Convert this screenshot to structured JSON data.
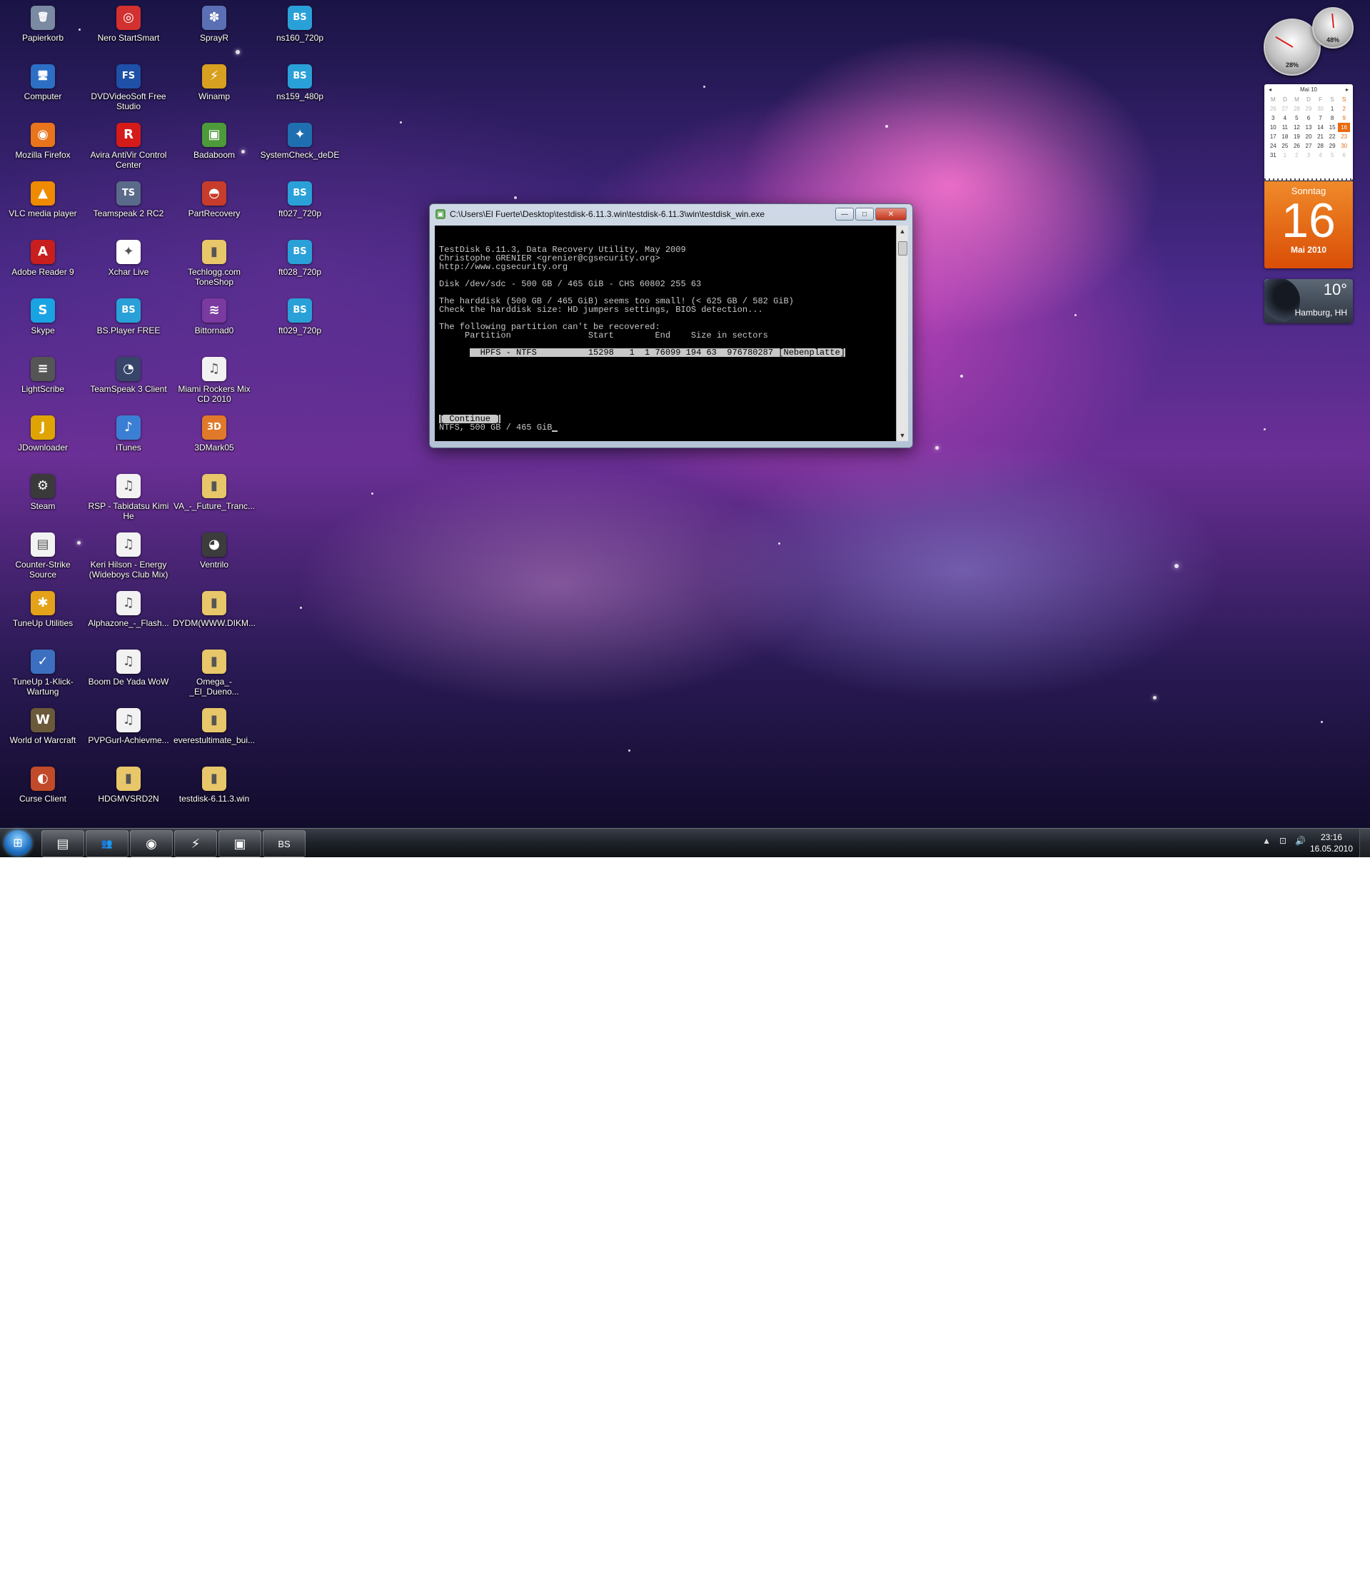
{
  "desktop_icons": [
    {
      "label": "Papierkorb",
      "icon": "recycle-bin-icon",
      "color": "#7b8aa3",
      "glyph": "🗑"
    },
    {
      "label": "Computer",
      "icon": "computer-icon",
      "color": "#2d6fc4",
      "glyph": "🖥"
    },
    {
      "label": "Mozilla Firefox",
      "icon": "firefox-icon",
      "color": "#e8741c",
      "glyph": "◉"
    },
    {
      "label": "VLC media player",
      "icon": "vlc-icon",
      "color": "#f08a00",
      "glyph": "▲"
    },
    {
      "label": "Adobe Reader 9",
      "icon": "adobe-reader-icon",
      "color": "#c81e1e",
      "glyph": "A"
    },
    {
      "label": "Skype",
      "icon": "skype-icon",
      "color": "#1aa3e3",
      "glyph": "S"
    },
    {
      "label": "LightScribe",
      "icon": "lightscribe-icon",
      "color": "#555555",
      "glyph": "≡"
    },
    {
      "label": "JDownloader",
      "icon": "jdownloader-icon",
      "color": "#e0a400",
      "glyph": "J"
    },
    {
      "label": "Steam",
      "icon": "steam-icon",
      "color": "#3a3a3a",
      "glyph": "⚙"
    },
    {
      "label": "Counter-Strike Source",
      "icon": "document-icon",
      "color": "#f2f2f2",
      "glyph": "▤"
    },
    {
      "label": "TuneUp Utilities",
      "icon": "tuneup-icon",
      "color": "#e3a21a",
      "glyph": "✱"
    },
    {
      "label": "TuneUp 1-Klick-Wartung",
      "icon": "tuneup-wartung-icon",
      "color": "#3c6fc0",
      "glyph": "✓"
    },
    {
      "label": "World of Warcraft",
      "icon": "wow-icon",
      "color": "#6b5a3a",
      "glyph": "W"
    },
    {
      "label": "Curse Client",
      "icon": "curse-client-icon",
      "color": "#c04a2a",
      "glyph": "◐"
    },
    {
      "label": "Nero StartSmart",
      "icon": "nero-icon",
      "color": "#d33030",
      "glyph": "◎"
    },
    {
      "label": "DVDVideoSoft Free Studio",
      "icon": "dvdvideosoft-icon",
      "color": "#1e50a8",
      "glyph": "FS"
    },
    {
      "label": "Avira AntiVir Control Center",
      "icon": "avira-icon",
      "color": "#d51a1a",
      "glyph": "R"
    },
    {
      "label": "Teamspeak 2 RC2",
      "icon": "teamspeak2-icon",
      "color": "#5a6a8a",
      "glyph": "TS"
    },
    {
      "label": "Xchar Live",
      "icon": "xchar-icon",
      "color": "#ffffff",
      "glyph": "✦"
    },
    {
      "label": "BS.Player FREE",
      "icon": "bsplayer-icon",
      "color": "#2aa0d8",
      "glyph": "BS"
    },
    {
      "label": "TeamSpeak 3 Client",
      "icon": "teamspeak3-icon",
      "color": "#38456a",
      "glyph": "◔"
    },
    {
      "label": "iTunes",
      "icon": "itunes-icon",
      "color": "#3b7fd4",
      "glyph": "♪"
    },
    {
      "label": "RSP - Tabidatsu Kimi He",
      "icon": "audio-file-icon",
      "color": "#f2f2f2",
      "glyph": "♫"
    },
    {
      "label": "Keri Hilson - Energy (Wideboys Club Mix)",
      "icon": "audio-file-icon",
      "color": "#f2f2f2",
      "glyph": "♫"
    },
    {
      "label": "Alphazone_-_Flash...",
      "icon": "audio-file-icon",
      "color": "#f2f2f2",
      "glyph": "♫"
    },
    {
      "label": "Boom De Yada WoW",
      "icon": "audio-file-icon",
      "color": "#f2f2f2",
      "glyph": "♫"
    },
    {
      "label": "PVPGurl-Achievme...",
      "icon": "audio-file-icon",
      "color": "#f2f2f2",
      "glyph": "♫"
    },
    {
      "label": "HDGMVSRD2N",
      "icon": "folder-icon",
      "color": "#e8c66a",
      "glyph": "▮"
    },
    {
      "label": "SprayR",
      "icon": "sprayr-icon",
      "color": "#5a6fb4",
      "glyph": "✽"
    },
    {
      "label": "Winamp",
      "icon": "winamp-icon",
      "color": "#d8a020",
      "glyph": "⚡"
    },
    {
      "label": "Badaboom",
      "icon": "badaboom-icon",
      "color": "#4d9a3a",
      "glyph": "▣"
    },
    {
      "label": "PartRecovery",
      "icon": "partrecovery-icon",
      "color": "#c83c2c",
      "glyph": "◓"
    },
    {
      "label": "Techlogg.com ToneShop",
      "icon": "folder-icon",
      "color": "#e8c66a",
      "glyph": "▮"
    },
    {
      "label": "Bittornad0",
      "icon": "bittornado-icon",
      "color": "#7a3aa0",
      "glyph": "≋"
    },
    {
      "label": "Miami Rockers Mix CD 2010",
      "icon": "audio-file-icon",
      "color": "#f2f2f2",
      "glyph": "♫"
    },
    {
      "label": "3DMark05",
      "icon": "3dmark-icon",
      "color": "#e07a2a",
      "glyph": "3D"
    },
    {
      "label": "VA_-_Future_Tranc...",
      "icon": "folder-icon",
      "color": "#e8c66a",
      "glyph": "▮"
    },
    {
      "label": "Ventrilo",
      "icon": "ventrilo-icon",
      "color": "#3c3c3c",
      "glyph": "◕"
    },
    {
      "label": "DYDM(WWW.DIKM...",
      "icon": "folder-icon",
      "color": "#e8c66a",
      "glyph": "▮"
    },
    {
      "label": "Omega_-_El_Dueno...",
      "icon": "folder-icon",
      "color": "#e8c66a",
      "glyph": "▮"
    },
    {
      "label": "everestultimate_bui...",
      "icon": "folder-icon",
      "color": "#e8c66a",
      "glyph": "▮"
    },
    {
      "label": "testdisk-6.11.3.win",
      "icon": "folder-icon",
      "color": "#e8c66a",
      "glyph": "▮"
    },
    {
      "label": "ns160_720p",
      "icon": "bsplayer-file-icon",
      "color": "#2aa0d8",
      "glyph": "BS"
    },
    {
      "label": "ns159_480p",
      "icon": "bsplayer-file-icon",
      "color": "#2aa0d8",
      "glyph": "BS"
    },
    {
      "label": "SystemCheck_deDE",
      "icon": "systemcheck-icon",
      "color": "#1f6fb0",
      "glyph": "✦"
    },
    {
      "label": "ft027_720p",
      "icon": "bsplayer-file-icon",
      "color": "#2aa0d8",
      "glyph": "BS"
    },
    {
      "label": "ft028_720p",
      "icon": "bsplayer-file-icon",
      "color": "#2aa0d8",
      "glyph": "BS"
    },
    {
      "label": "ft029_720p",
      "icon": "bsplayer-file-icon",
      "color": "#2aa0d8",
      "glyph": "BS"
    }
  ],
  "console_window": {
    "title": "C:\\Users\\El Fuerte\\Desktop\\testdisk-6.11.3.win\\testdisk-6.11.3\\win\\testdisk_win.exe",
    "buttons": {
      "minimize": "—",
      "maximize": "□",
      "close": "✕"
    },
    "lines": [
      "TestDisk 6.11.3, Data Recovery Utility, May 2009",
      "Christophe GRENIER <grenier@cgsecurity.org>",
      "http://www.cgsecurity.org",
      "",
      "Disk /dev/sdc - 500 GB / 465 GiB - CHS 60802 255 63",
      "",
      "The harddisk (500 GB / 465 GiB) seems too small! (< 625 GB / 582 GiB)",
      "Check the harddisk size: HD jumpers settings, BIOS detection...",
      "",
      "The following partition can't be recovered:",
      "     Partition               Start        End    Size in sectors"
    ],
    "selected_row": "  HPFS - NTFS          15298   1  1 76099 194 63  976780287 [Nebenplatte]",
    "continue_label": "[ Continue ]",
    "bottom_line": "NTFS, 500 GB / 465 GiB"
  },
  "taskbar": {
    "start_label": "Start",
    "pinned": [
      {
        "name": "explorer",
        "icon": "folder-icon",
        "glyph": "▤"
      },
      {
        "name": "users",
        "icon": "users-icon",
        "glyph": "👥"
      },
      {
        "name": "firefox",
        "icon": "firefox-icon",
        "glyph": "◉"
      },
      {
        "name": "winamp",
        "icon": "winamp-icon",
        "glyph": "⚡"
      },
      {
        "name": "testdisk",
        "icon": "console-icon",
        "glyph": "▣"
      },
      {
        "name": "bsplayer",
        "icon": "bsplayer-icon",
        "glyph": "BS"
      }
    ],
    "tray": {
      "up_arrow": "▲",
      "network": "⊡",
      "volume": "🔊"
    },
    "clock_time": "23:16",
    "clock_date": "16.05.2010"
  },
  "gadgets": {
    "cpu_meter": {
      "cpu_percent": 28,
      "cpu_label": "28%",
      "ram_percent": 48,
      "ram_label": "48%"
    },
    "calendar": {
      "month_label": "Mai 10",
      "weekdays": [
        "M",
        "D",
        "M",
        "D",
        "F",
        "S",
        "S"
      ],
      "weeks": [
        [
          "26",
          "27",
          "28",
          "29",
          "30",
          "1",
          "2"
        ],
        [
          "3",
          "4",
          "5",
          "6",
          "7",
          "8",
          "9"
        ],
        [
          "10",
          "11",
          "12",
          "13",
          "14",
          "15",
          "16"
        ],
        [
          "17",
          "18",
          "19",
          "20",
          "21",
          "22",
          "23"
        ],
        [
          "24",
          "25",
          "26",
          "27",
          "28",
          "29",
          "30"
        ],
        [
          "31",
          "1",
          "2",
          "3",
          "4",
          "5",
          "6"
        ]
      ],
      "today": "16"
    },
    "day": {
      "weekday": "Sonntag",
      "number": "16",
      "month_year": "Mai 2010"
    },
    "weather": {
      "temperature": "10°",
      "city": "Hamburg, HH"
    }
  }
}
